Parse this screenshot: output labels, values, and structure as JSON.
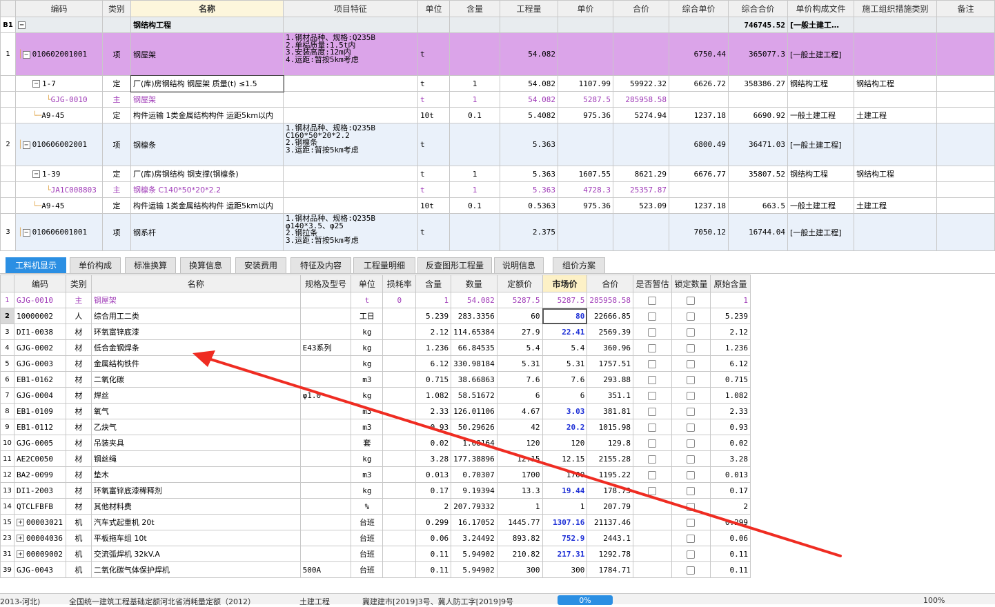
{
  "top": {
    "headers": [
      "编码",
      "类别",
      "名称",
      "项目特征",
      "单位",
      "含量",
      "工程量",
      "单价",
      "合价",
      "综合单价",
      "综合合价",
      "单价构成文件",
      "施工组织措施类别",
      "备注"
    ],
    "b1": {
      "rn": "B1",
      "name": "钢结构工程",
      "zhhj": "746745.52",
      "file": "[一般土建工…"
    },
    "rows": [
      {
        "rn": "1",
        "kind": "qd1",
        "code": "010602001001",
        "type": "项",
        "name": "钢屋架",
        "feat": "1.钢材品种、规格:Q235B\n2.单榀质量:1.5t内\n3.安装高度:12m内\n4.运距:暂按5km考虑",
        "unit": "t",
        "hl": "",
        "gcl": "54.082",
        "dj": "",
        "hj": "",
        "zhdj": "6750.44",
        "zhhj": "365077.3",
        "file": "[一般土建工程]",
        "cat": ""
      },
      {
        "rn": "",
        "kind": "sub",
        "code": "1-7",
        "type": "定",
        "name": "厂(库)房钢结构 钢屋架 质量(t) ≤1.5",
        "feat": "",
        "unit": "t",
        "hl": "1",
        "gcl": "54.082",
        "dj": "1107.99",
        "hj": "59922.32",
        "zhdj": "6626.72",
        "zhhj": "358386.27",
        "file": "钢结构工程",
        "cat": "钢结构工程"
      },
      {
        "rn": "",
        "kind": "zhu",
        "code": "GJG-0010",
        "type": "主",
        "name": "钢屋架",
        "feat": "",
        "unit": "t",
        "hl": "1",
        "gcl": "54.082",
        "dj": "5287.5",
        "hj": "285958.58",
        "zhdj": "",
        "zhhj": "",
        "file": "",
        "cat": ""
      },
      {
        "rn": "",
        "kind": "sub",
        "code": "A9-45",
        "type": "定",
        "name": "构件运输 1类金属结构构件 运距5km以内",
        "feat": "",
        "unit": "10t",
        "hl": "0.1",
        "gcl": "5.4082",
        "dj": "975.36",
        "hj": "5274.94",
        "zhdj": "1237.18",
        "zhhj": "6690.92",
        "file": "一般土建工程",
        "cat": "土建工程"
      },
      {
        "rn": "2",
        "kind": "qd",
        "code": "010606002001",
        "type": "项",
        "name": "钢檩条",
        "feat": "1.钢材品种、规格:Q235B\nC160*50*20*2.2\n2.钢檩条\n3.运距:暂按5km考虑",
        "unit": "t",
        "hl": "",
        "gcl": "5.363",
        "dj": "",
        "hj": "",
        "zhdj": "6800.49",
        "zhhj": "36471.03",
        "file": "[一般土建工程]",
        "cat": ""
      },
      {
        "rn": "",
        "kind": "sub",
        "code": "1-39",
        "type": "定",
        "name": "厂(库)房钢结构 钢支撑(钢檩条)",
        "feat": "",
        "unit": "t",
        "hl": "1",
        "gcl": "5.363",
        "dj": "1607.55",
        "hj": "8621.29",
        "zhdj": "6676.77",
        "zhhj": "35807.52",
        "file": "钢结构工程",
        "cat": "钢结构工程"
      },
      {
        "rn": "",
        "kind": "zhu",
        "code": "JA1C008803",
        "type": "主",
        "name": "钢檩条 C140*50*20*2.2",
        "feat": "",
        "unit": "t",
        "hl": "1",
        "gcl": "5.363",
        "dj": "4728.3",
        "hj": "25357.87",
        "zhdj": "",
        "zhhj": "",
        "file": "",
        "cat": ""
      },
      {
        "rn": "",
        "kind": "sub",
        "code": "A9-45",
        "type": "定",
        "name": "构件运输 1类金属结构构件 运距5km以内",
        "feat": "",
        "unit": "10t",
        "hl": "0.1",
        "gcl": "0.5363",
        "dj": "975.36",
        "hj": "523.09",
        "zhdj": "1237.18",
        "zhhj": "663.5",
        "file": "一般土建工程",
        "cat": "土建工程"
      },
      {
        "rn": "3",
        "kind": "qd",
        "code": "010606001001",
        "type": "项",
        "name": "钢系杆",
        "feat": "1.钢材品种、规格:Q235B\nφ140*3.5、φ25\n2.钢拉条\n3.运距:暂按5km考虑",
        "unit": "t",
        "hl": "",
        "gcl": "2.375",
        "dj": "",
        "hj": "",
        "zhdj": "7050.12",
        "zhhj": "16744.04",
        "file": "[一般土建工程]",
        "cat": ""
      }
    ]
  },
  "tabs": [
    "工料机显示",
    "单价构成",
    "标准换算",
    "换算信息",
    "安装费用",
    "特征及内容",
    "工程量明细",
    "反查图形工程量",
    "说明信息",
    "组价方案"
  ],
  "bottom": {
    "headers": [
      "",
      "编码",
      "类别",
      "名称",
      "规格及型号",
      "单位",
      "损耗率",
      "含量",
      "数量",
      "定额价",
      "市场价",
      "合价",
      "是否暂估",
      "锁定数量",
      "原始含量"
    ],
    "rows": [
      {
        "rn": "1",
        "code": "GJG-0010",
        "type": "主",
        "name": "钢屋架",
        "spec": "",
        "unit": "t",
        "loss": "0",
        "hl": "1",
        "sl": "54.082",
        "dej": "5287.5",
        "scj": "5287.5",
        "hj": "285958.58",
        "yshl": "1",
        "tog": "",
        "blue": false
      },
      {
        "rn": "2",
        "code": "10000002",
        "type": "人",
        "name": "综合用工二类",
        "spec": "",
        "unit": "工日",
        "loss": "",
        "hl": "5.239",
        "sl": "283.3356",
        "dej": "60",
        "scj": "80",
        "hj": "22666.85",
        "yshl": "5.239",
        "tog": "",
        "blue": true
      },
      {
        "rn": "3",
        "code": "DI1-0038",
        "type": "材",
        "name": "环氧富锌底漆",
        "spec": "",
        "unit": "kg",
        "loss": "",
        "hl": "2.12",
        "sl": "114.65384",
        "dej": "27.9",
        "scj": "22.41",
        "hj": "2569.39",
        "yshl": "2.12",
        "tog": "",
        "blue": true
      },
      {
        "rn": "4",
        "code": "GJG-0002",
        "type": "材",
        "name": "低合金钢焊条",
        "spec": "E43系列",
        "unit": "kg",
        "loss": "",
        "hl": "1.236",
        "sl": "66.84535",
        "dej": "5.4",
        "scj": "5.4",
        "hj": "360.96",
        "yshl": "1.236",
        "tog": "",
        "blue": false
      },
      {
        "rn": "5",
        "code": "GJG-0003",
        "type": "材",
        "name": "金属结构铁件",
        "spec": "",
        "unit": "kg",
        "loss": "",
        "hl": "6.12",
        "sl": "330.98184",
        "dej": "5.31",
        "scj": "5.31",
        "hj": "1757.51",
        "yshl": "6.12",
        "tog": "",
        "blue": false
      },
      {
        "rn": "6",
        "code": "EB1-0162",
        "type": "材",
        "name": "二氧化碳",
        "spec": "",
        "unit": "m3",
        "loss": "",
        "hl": "0.715",
        "sl": "38.66863",
        "dej": "7.6",
        "scj": "7.6",
        "hj": "293.88",
        "yshl": "0.715",
        "tog": "",
        "blue": false
      },
      {
        "rn": "7",
        "code": "GJG-0004",
        "type": "材",
        "name": "焊丝",
        "spec": "φ1.0",
        "unit": "kg",
        "loss": "",
        "hl": "1.082",
        "sl": "58.51672",
        "dej": "6",
        "scj": "6",
        "hj": "351.1",
        "yshl": "1.082",
        "tog": "",
        "blue": false
      },
      {
        "rn": "8",
        "code": "EB1-0109",
        "type": "材",
        "name": "氧气",
        "spec": "",
        "unit": "m3",
        "loss": "",
        "hl": "2.33",
        "sl": "126.01106",
        "dej": "4.67",
        "scj": "3.03",
        "hj": "381.81",
        "yshl": "2.33",
        "tog": "",
        "blue": true
      },
      {
        "rn": "9",
        "code": "EB1-0112",
        "type": "材",
        "name": "乙炔气",
        "spec": "",
        "unit": "m3",
        "loss": "",
        "hl": "0.93",
        "sl": "50.29626",
        "dej": "42",
        "scj": "20.2",
        "hj": "1015.98",
        "yshl": "0.93",
        "tog": "",
        "blue": true
      },
      {
        "rn": "10",
        "code": "GJG-0005",
        "type": "材",
        "name": "吊装夹具",
        "spec": "",
        "unit": "套",
        "loss": "",
        "hl": "0.02",
        "sl": "1.08164",
        "dej": "120",
        "scj": "120",
        "hj": "129.8",
        "yshl": "0.02",
        "tog": "",
        "blue": false
      },
      {
        "rn": "11",
        "code": "AE2C0050",
        "type": "材",
        "name": "钢丝绳",
        "spec": "",
        "unit": "kg",
        "loss": "",
        "hl": "3.28",
        "sl": "177.38896",
        "dej": "12.15",
        "scj": "12.15",
        "hj": "2155.28",
        "yshl": "3.28",
        "tog": "",
        "blue": false
      },
      {
        "rn": "12",
        "code": "BA2-0099",
        "type": "材",
        "name": "垫木",
        "spec": "",
        "unit": "m3",
        "loss": "",
        "hl": "0.013",
        "sl": "0.70307",
        "dej": "1700",
        "scj": "1700",
        "hj": "1195.22",
        "yshl": "0.013",
        "tog": "",
        "blue": false
      },
      {
        "rn": "13",
        "code": "DI1-2003",
        "type": "材",
        "name": "环氧富锌底漆稀释剂",
        "spec": "",
        "unit": "kg",
        "loss": "",
        "hl": "0.17",
        "sl": "9.19394",
        "dej": "13.3",
        "scj": "19.44",
        "hj": "178.73",
        "yshl": "0.17",
        "tog": "",
        "blue": true
      },
      {
        "rn": "14",
        "code": "QTCLFBFB",
        "type": "材",
        "name": "其他材料费",
        "spec": "",
        "unit": "%",
        "loss": "",
        "hl": "2",
        "sl": "207.79332",
        "dej": "1",
        "scj": "1",
        "hj": "207.79",
        "yshl": "2",
        "tog": "",
        "blue": false
      },
      {
        "rn": "15",
        "code": "00003021",
        "type": "机",
        "name": "汽车式起重机 20t",
        "spec": "",
        "unit": "台班",
        "loss": "",
        "hl": "0.299",
        "sl": "16.17052",
        "dej": "1445.77",
        "scj": "1307.16",
        "hj": "21137.46",
        "yshl": "0.299",
        "tog": "+",
        "blue": true
      },
      {
        "rn": "23",
        "code": "00004036",
        "type": "机",
        "name": "平板拖车组 10t",
        "spec": "",
        "unit": "台班",
        "loss": "",
        "hl": "0.06",
        "sl": "3.24492",
        "dej": "893.82",
        "scj": "752.9",
        "hj": "2443.1",
        "yshl": "0.06",
        "tog": "+",
        "blue": true
      },
      {
        "rn": "31",
        "code": "00009002",
        "type": "机",
        "name": "交流弧焊机 32kV.A",
        "spec": "",
        "unit": "台班",
        "loss": "",
        "hl": "0.11",
        "sl": "5.94902",
        "dej": "210.82",
        "scj": "217.31",
        "hj": "1292.78",
        "yshl": "0.11",
        "tog": "+",
        "blue": true
      },
      {
        "rn": "39",
        "code": "GJG-0043",
        "type": "机",
        "name": "二氧化碳气体保护焊机",
        "spec": "500A",
        "unit": "台班",
        "loss": "",
        "hl": "0.11",
        "sl": "5.94902",
        "dej": "300",
        "scj": "300",
        "hj": "1784.71",
        "yshl": "0.11",
        "tog": "",
        "blue": false
      }
    ]
  },
  "status": {
    "items": [
      "2013-河北)",
      "全国统一建筑工程基础定额河北省消耗量定额（2012）",
      "土建工程",
      "冀建建市[2019]3号、冀人防工字[2019]9号"
    ],
    "button": "0%",
    "zoom": "100%"
  },
  "colors": {
    "accent": "#2b8fe3",
    "qd1": "#dba4e9",
    "qd": "#eaf1fa",
    "zhu_text": "#a03cb8",
    "market_blue": "#1d2fd6",
    "arrow": "#ef2c22"
  }
}
